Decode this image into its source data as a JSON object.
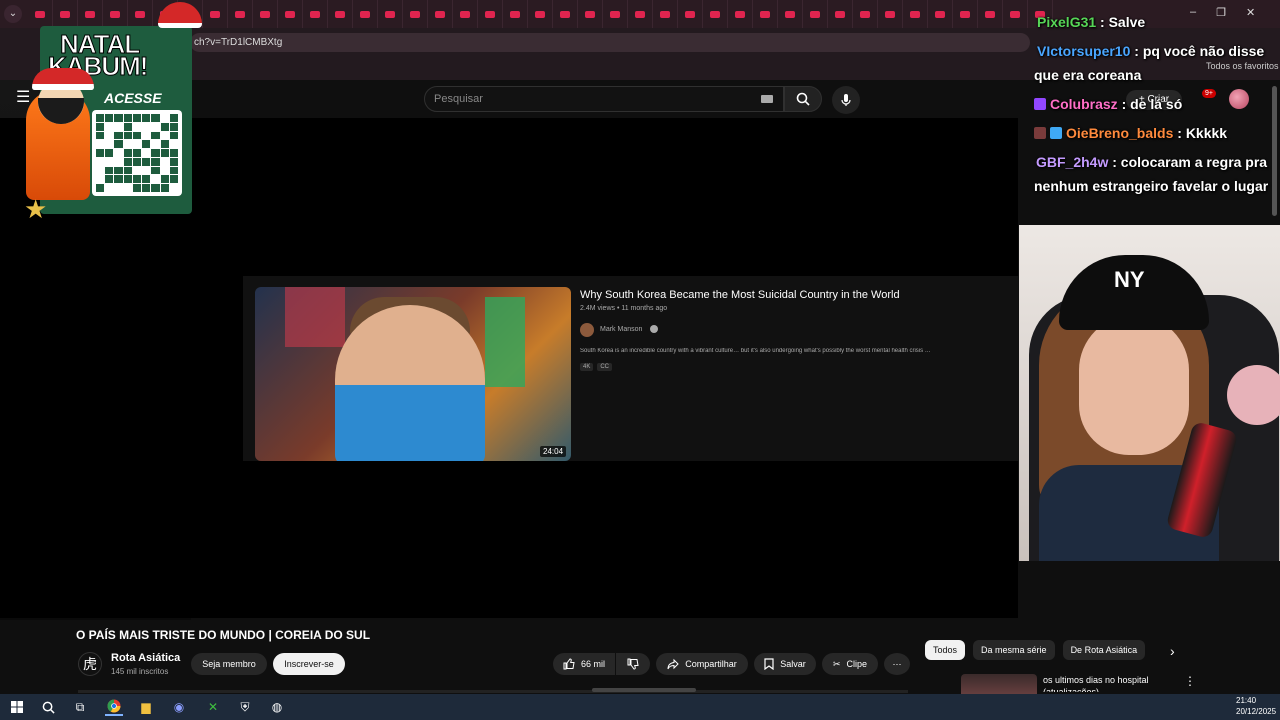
{
  "browser": {
    "url_fragment": "ch?v=TrD1lCMBXtg",
    "bookmarks_label": "Todos os favoritos"
  },
  "youtube": {
    "search_placeholder": "Pesquisar",
    "create_label": "+ Criar",
    "notif_count": "9+"
  },
  "player_card": {
    "title": "Why South Korea Became the Most Suicidal Country in the World",
    "meta": "2.4M views • 11 months ago",
    "channel": "Mark Manson",
    "description": "South Korea is an incredible country with a vibrant culture… but it's also undergoing what's possibly the worst mental health crisis …",
    "badges": [
      "4K",
      "CC"
    ],
    "duration": "24:04"
  },
  "overlay": {
    "brand_line1": "NATAL",
    "brand_line2": "KABUM!",
    "cta": "ACESSE"
  },
  "chat": [
    {
      "user": "PixelG31",
      "message": ": Salve",
      "color": "#57d657"
    },
    {
      "user": "VIctorsuper10",
      "message": ": pq você não disse que era coreana",
      "color": "#4aa6ff"
    },
    {
      "user": "Colubrasz",
      "message": ": de lá só",
      "color": "#ff6ec7"
    },
    {
      "user": "OieBreno_balds",
      "message": ": Kkkkk",
      "color": "#ff8a3d"
    },
    {
      "user": "GBF_2h4w",
      "message": ": colocaram a regra pra nenhum estrangeiro favelar o lugar",
      "color": "#c49bff"
    }
  ],
  "webcam": {
    "cap_text": "NY"
  },
  "video": {
    "title": "O PAÍS MAIS TRISTE DO MUNDO | COREIA DO SUL",
    "channel_name": "Rota Asiática",
    "channel_avatar_glyph": "虎",
    "subscribers": "145 mil inscritos",
    "member_label": "Seja membro",
    "subscribe_label": "Inscrever-se",
    "likes": "66 mil",
    "share_label": "Compartilhar",
    "save_label": "Salvar",
    "clip_label": "Clipe",
    "more_label": "⋯"
  },
  "sidebar_chips": [
    "Todos",
    "Da mesma série",
    "De Rota Asiática"
  ],
  "recommendation": {
    "title": "os ultimos dias no hospital (atualizações)"
  },
  "taskbar": {
    "time": "21:40",
    "date": "20/12/2025"
  },
  "colors": {
    "accent": "#e0244f",
    "youtube_bg": "#0f0f0f",
    "kabum_green": "#1e5c3e"
  }
}
